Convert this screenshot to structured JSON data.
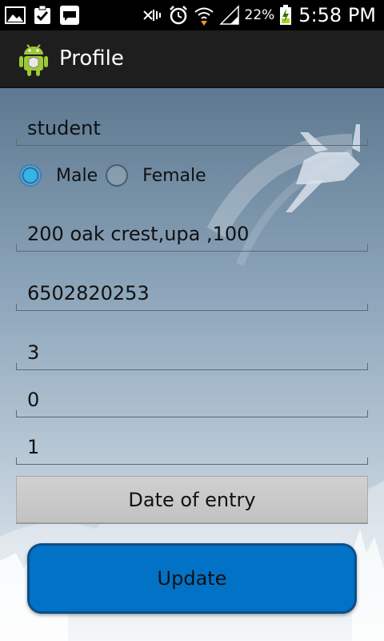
{
  "status_bar": {
    "battery_percent": "22%",
    "time": "5:58 PM",
    "icons": [
      "gallery-icon",
      "clipboard-check-icon",
      "messenger-icon",
      "mute-icon",
      "alarm-icon",
      "wifi-icon",
      "signal-icon",
      "battery-charging-icon"
    ]
  },
  "action_bar": {
    "title": "Profile",
    "icon": "android-app-icon"
  },
  "form": {
    "occupation": "student",
    "gender": {
      "options": [
        "Male",
        "Female"
      ],
      "selected": "Male"
    },
    "address": "200 oak crest,upa ,100",
    "phone": "6502820253",
    "field_5": "3",
    "field_6": "0",
    "field_7": "1",
    "date_button": "Date of entry",
    "update_button": "Update"
  },
  "colors": {
    "accent": "#33b5e5",
    "update_button": "#0272c6",
    "action_bar": "#1e1e1e"
  }
}
